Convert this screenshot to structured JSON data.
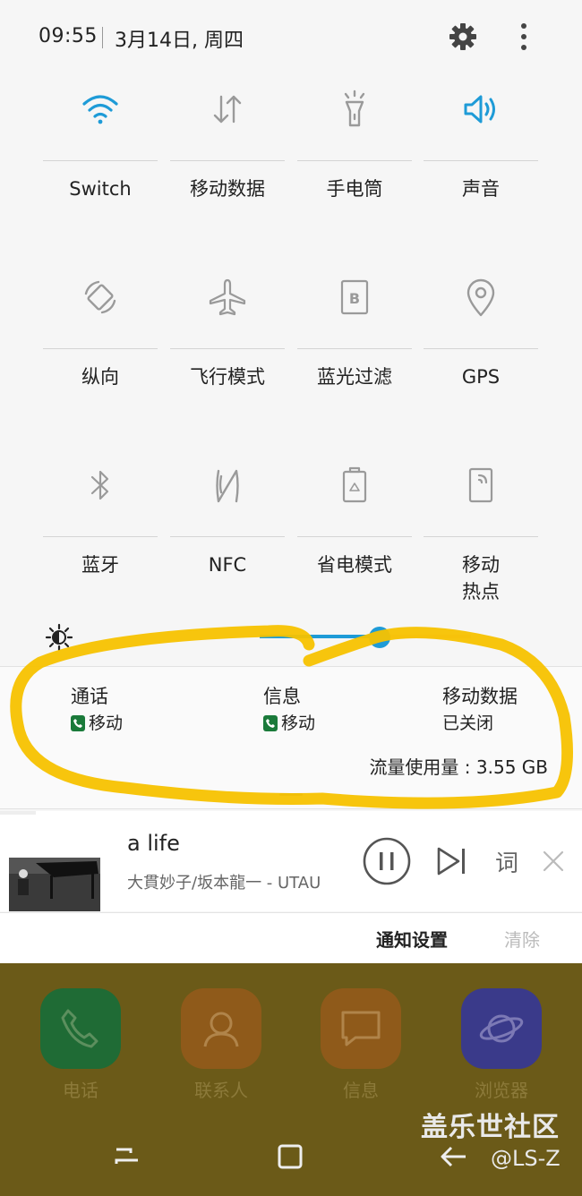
{
  "status": {
    "time": "09:55",
    "date": "3月14日, 周四"
  },
  "tiles": [
    {
      "label": "Switch",
      "icon": "wifi-icon",
      "active": true
    },
    {
      "label": "移动数据",
      "icon": "mobile-data-icon",
      "active": false
    },
    {
      "label": "手电筒",
      "icon": "flashlight-icon",
      "active": false
    },
    {
      "label": "声音",
      "icon": "sound-icon",
      "active": true
    },
    {
      "label": "纵向",
      "icon": "rotation-icon",
      "active": false
    },
    {
      "label": "飞行模式",
      "icon": "airplane-icon",
      "active": false
    },
    {
      "label": "蓝光过滤",
      "icon": "blue-light-filter-icon",
      "active": false
    },
    {
      "label": "GPS",
      "icon": "location-icon",
      "active": false
    },
    {
      "label": "蓝牙",
      "icon": "bluetooth-icon",
      "active": false
    },
    {
      "label": "NFC",
      "icon": "nfc-icon",
      "active": false
    },
    {
      "label": "省电模式",
      "icon": "battery-saver-icon",
      "active": false
    },
    {
      "label": "移动\n热点",
      "icon": "hotspot-icon",
      "active": false
    }
  ],
  "usage": {
    "call": {
      "title": "通话",
      "sim": "移动"
    },
    "sms": {
      "title": "信息",
      "sim": "移动"
    },
    "data": {
      "title": "移动数据",
      "status": "已关闭"
    },
    "flow": "流量使用量 : 3.55 GB"
  },
  "media": {
    "title": "a life",
    "artist": "大貫妙子/坂本龍一 - UTAU",
    "lyrics": "词"
  },
  "notif": {
    "settings": "通知设置",
    "clear": "清除"
  },
  "dock": [
    {
      "name": "电话",
      "icon": "phone-icon",
      "color": "#1f6b35"
    },
    {
      "name": "联系人",
      "icon": "contacts-icon",
      "color": "#8f5a1a"
    },
    {
      "name": "信息",
      "icon": "message-icon",
      "color": "#8f5a1a"
    },
    {
      "name": "浏览器",
      "icon": "browser-icon",
      "color": "#3a3a8a"
    }
  ],
  "watermark": {
    "site": "盖乐世社区",
    "user": "@LS-Z"
  },
  "colors": {
    "accent": "#1e9bd7",
    "highlight": "#f7c200"
  }
}
